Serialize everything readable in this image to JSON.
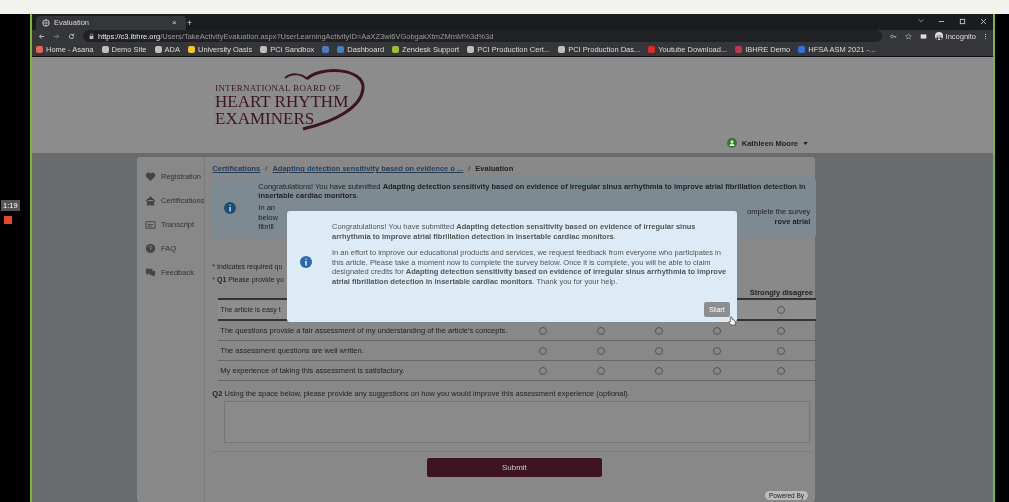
{
  "recording": {
    "timer": "1:19"
  },
  "browser": {
    "tabs": [
      {
        "title": "Evaluation",
        "selected": true
      }
    ],
    "close_tab": "×",
    "new_tab": "+",
    "url": {
      "host": "https://c3.ibhre.org",
      "path": "/Users/TakeActivityEvaluation.aspx?UserLearningActivityID=AaXZ3wi6VGobgakXtmZMmM%3d%3d"
    },
    "profile": "Incognito",
    "bookmarks": [
      {
        "label": "Home - Asana",
        "color": "#e8615a"
      },
      {
        "label": "Demo Site",
        "color": "#bdbdbd"
      },
      {
        "label": "ADA",
        "color": "#bdbdbd"
      },
      {
        "label": "University Oasis",
        "color": "#f2c230"
      },
      {
        "label": "PCI Sandbox",
        "color": "#bdbdbd"
      },
      {
        "color": "#4a7ebf"
      },
      {
        "label": "Dashboard",
        "color": "#4a7ebf"
      },
      {
        "label": "Zendesk Support",
        "color": "#9bbf3a"
      },
      {
        "label": "PCI Production Cert...",
        "color": "#bdbdbd"
      },
      {
        "label": "PCI Production Das...",
        "color": "#bdbdbd"
      },
      {
        "label": "Youtube Download...",
        "color": "#e02b2b"
      },
      {
        "label": "IBHRE Demo",
        "color": "#c0394b"
      },
      {
        "label": "HFSA ASM 2021 -...",
        "color": "#3a6fd8"
      }
    ]
  },
  "header": {
    "logo": [
      "INTERNATIONAL BOARD OF",
      "HEART RHYTHM",
      "EXAMINERS"
    ],
    "user": "Kathleen Moore"
  },
  "sidebar": {
    "items": [
      {
        "label": "Registration",
        "kind": "heart"
      },
      {
        "label": "Certifications",
        "kind": "home"
      },
      {
        "label": "Transcript",
        "kind": "card"
      },
      {
        "label": "FAQ",
        "kind": "question"
      },
      {
        "label": "Feedback",
        "kind": "chat"
      }
    ]
  },
  "breadcrumb": [
    {
      "label": "Certifications",
      "kind": "link"
    },
    {
      "label": "/",
      "kind": "separator"
    },
    {
      "label": "Adapting detection sensitivity based on evidence o ...",
      "kind": "link"
    },
    {
      "label": "/",
      "kind": "separator"
    },
    {
      "label": "Evaluation",
      "kind": "current"
    }
  ],
  "alert": {
    "message": "Congratulations! You have submitted **Adapting detection sensitivity based on evidence of irregular sinus arrhythmia to improve atrial fibrillation detection in insertable cardiac monitors**.",
    "fragments_left": [
      "In an",
      "below",
      "fibrill"
    ],
    "fragments_right": [
      "omplete the survey",
      "**rove atrial**"
    ]
  },
  "required_note": "* Indicates required qu",
  "q1": {
    "marker": "*",
    "number": "Q1",
    "text": "Please provide yo"
  },
  "table": {
    "columns": [
      "Strongly disagree"
    ],
    "rows": [
      {
        "statement": "The article is easy t",
        "options": [
          {
            "selected": false
          }
        ]
      },
      {
        "statement": "The questions provide a fair assessment of my understanding of the article's concepts.",
        "options": [
          {
            "selected": false
          },
          {
            "selected": false
          },
          {
            "selected": false
          },
          {
            "selected": false
          },
          {
            "selected": false
          }
        ]
      },
      {
        "statement": "The assessment questions are well written.",
        "options": [
          {
            "selected": false
          },
          {
            "selected": false
          },
          {
            "selected": false
          },
          {
            "selected": false
          },
          {
            "selected": false
          }
        ]
      },
      {
        "statement": "My experience of taking this assessment is satisfactory.",
        "options": [
          {
            "selected": false
          },
          {
            "selected": false
          },
          {
            "selected": false
          },
          {
            "selected": false
          },
          {
            "selected": false
          }
        ]
      }
    ]
  },
  "q2": {
    "number": "Q2",
    "text": "Using the space below, please provide any suggestions on how you would improve this assessment experience (optional)."
  },
  "submit": "Submit",
  "powered_by": "Powered By",
  "modal": {
    "paragraphs": [
      "Congratulations! You have submitted **Adapting detection sensitivity based on evidence of irregular sinus arrhythmia to improve atrial fibrillation detection in insertable cardiac monitors**.",
      "In an effort to improve our educational products and services, we request feedback from everyone who participates in this article. Please take a moment now to complete the survey below. Once it is complete, you will be able to claim designated credits for **Adapting detection sensitivity based on evidence of irregular sinus arrhythmia to improve atrial fibrillation detection in insertable cardiac monitors**. Thank you for your help."
    ],
    "button": "Start"
  }
}
